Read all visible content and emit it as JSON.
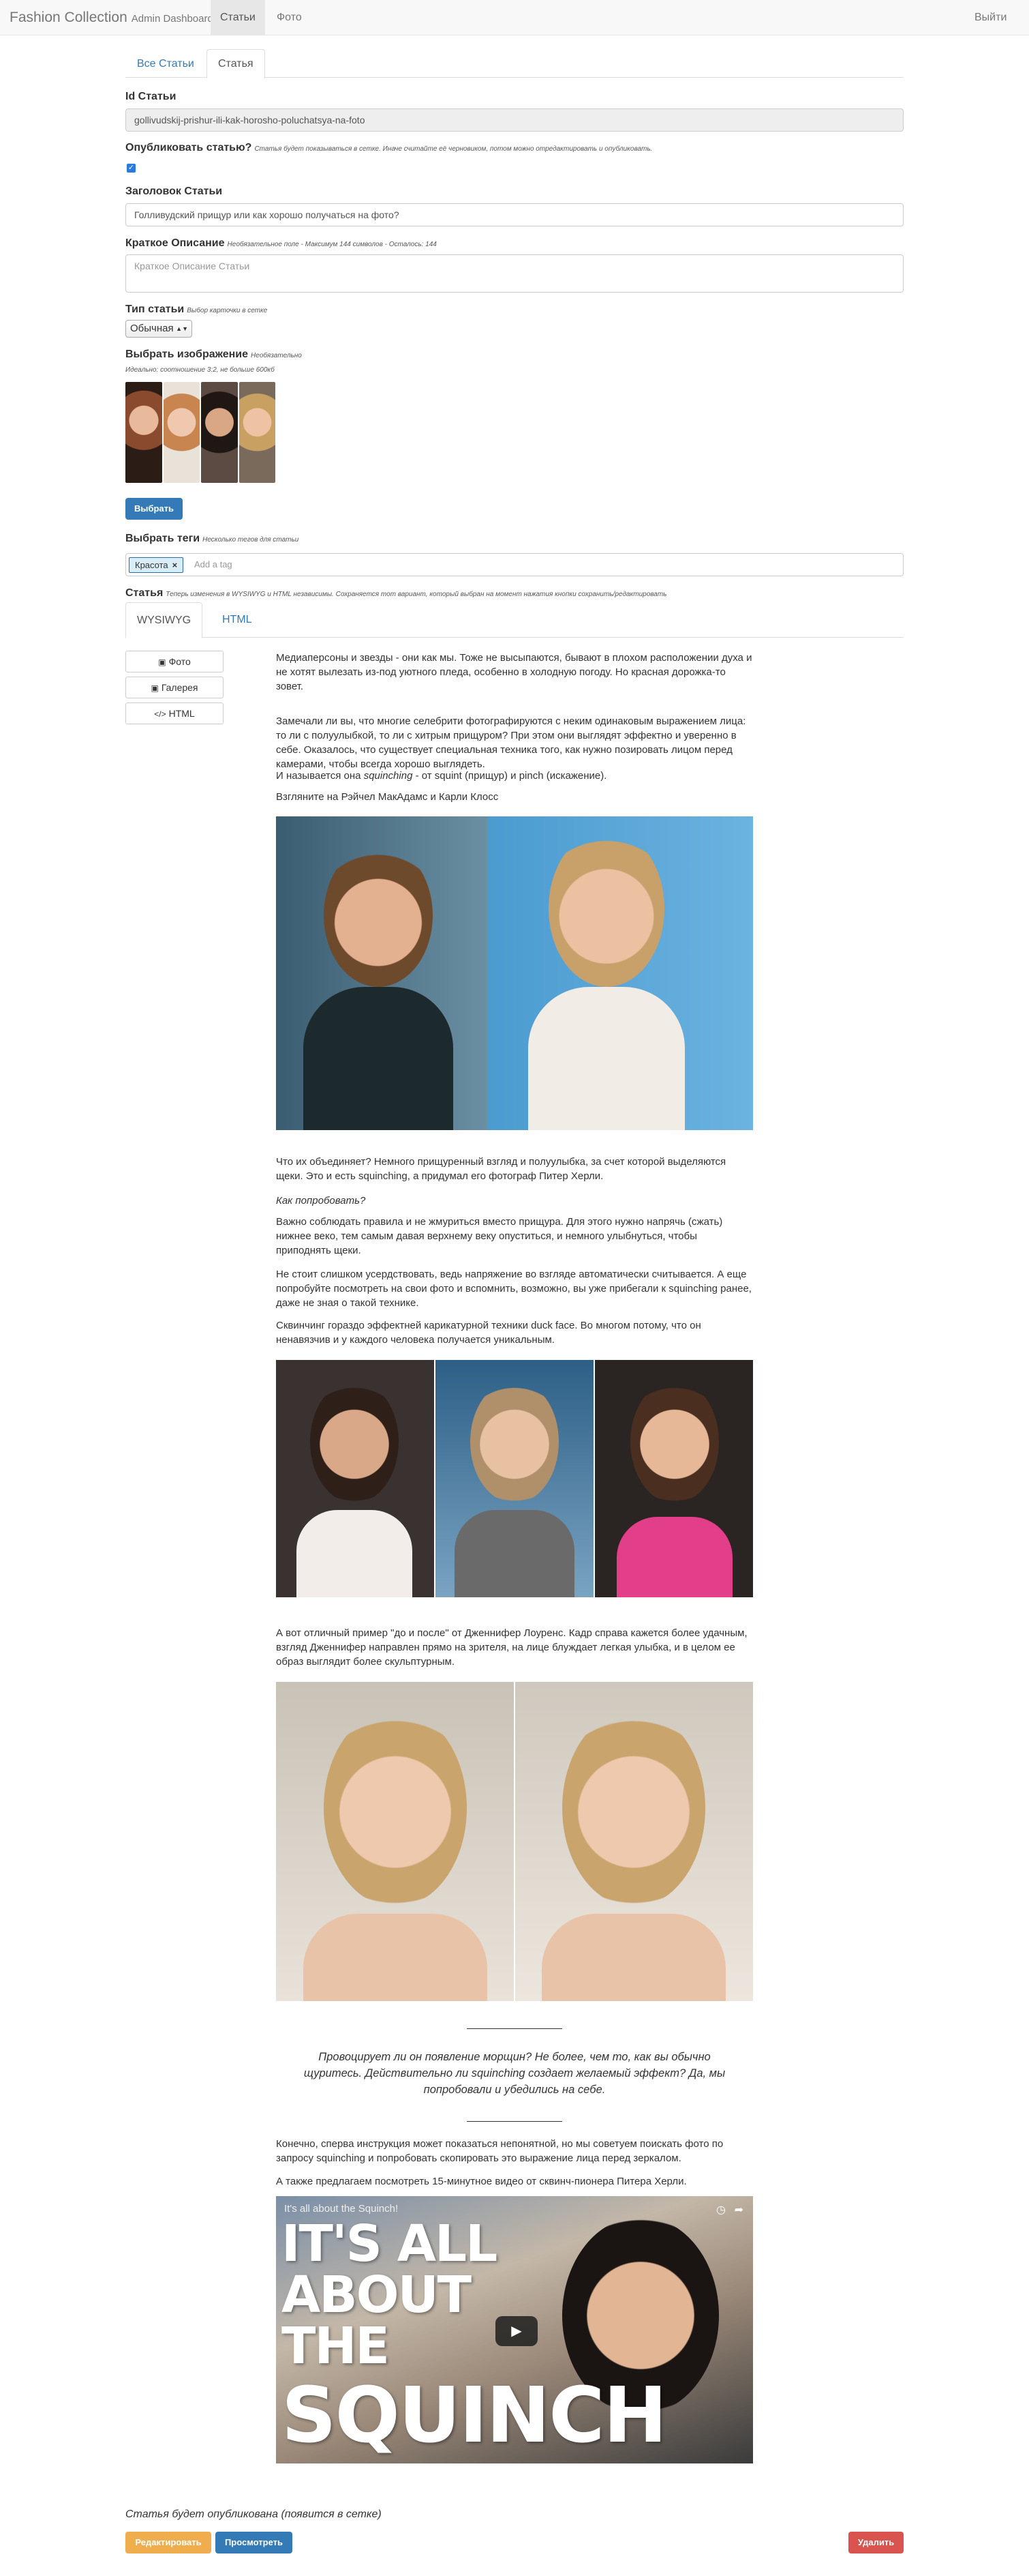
{
  "navbar": {
    "brand": "Fashion Collection",
    "brand_sub": "Admin Dashboard",
    "links": [
      "Статьи",
      "Фото"
    ],
    "logout": "Выйти"
  },
  "tabs": [
    "Все Статьи",
    "Статья"
  ],
  "form": {
    "id_label": "Id Статьи",
    "id_value": "gollivudskij-prishur-ili-kak-horosho-poluchatsya-na-foto",
    "publish_label": "Опубликовать статью?",
    "publish_hint": "Статья будет показываться в сетке. Иначе считайте её черновиком, потом можно отредактировать и опубликовать.",
    "publish_checked": true,
    "title_label": "Заголовок Статьи",
    "title_value": "Голливудский прищур или как хорошо получаться на фото?",
    "summary_label": "Краткое Описание",
    "summary_hint": "Необязательное поле - Максимум 144 символов - Осталось: 144",
    "summary_placeholder": "Краткое Описание Статьи",
    "type_label": "Тип статьи",
    "type_hint": "Выбор карточки в сетке",
    "type_value": "Обычная",
    "image_label": "Выбрать изображение",
    "image_hint": "Необязательно",
    "image_note": "Идеально: соотношение 3:2, не больше 600кб",
    "choose_button": "Выбрать",
    "tags_label": "Выбрать теги",
    "tags_hint": "Несколько тегов для статьи",
    "tags": [
      "Красота"
    ],
    "tags_placeholder": "Add a tag",
    "article_label": "Статья",
    "article_hint": "Теперь изменения в WYSIWYG и HTML независимы. Сохраняется тот вариант, который выбран на момент нажатия кнопки сохранить/редактировать"
  },
  "editor_tabs": [
    "WYSIWYG",
    "HTML"
  ],
  "side_buttons": [
    "Фото",
    "Галерея",
    "HTML"
  ],
  "article": {
    "p1": "Медиаперсоны и звезды - они как мы. Тоже не высыпаются, бывают в плохом расположении духа и не хотят вылезать из-под уютного пледа, особенно в холодную погоду. Но красная дорожка-то зовет.",
    "p2": "Замечали ли вы, что многие селебрити фотографируются с неким одинаковым выражением лица: то ли с полуулыбкой, то ли с хитрым прищуром? При этом они выглядят эффектно и уверенно в себе. Оказалось, что существует специальная техника того, как нужно позировать лицом перед камерами, чтобы всегда хорошо выглядеть.",
    "p3": "И называется она squinching - от squint (прищур) и pinch (искажение).",
    "p4": "Взгляните на Рэйчел МакАдамс и Карли Клосс",
    "p5": "Что их объединяет? Немного прищуренный взгляд и полуулыбка, за счет которой выделяются щеки. Это и есть squinching, а придумал его фотограф Питер Херли.",
    "p6": "Как попробовать?",
    "p7": "Важно соблюдать правила и не жмуриться вместо прищура. Для этого нужно напрячь (сжать) нижнее веко, тем самым давая верхнему веку опуститься, и немного улыбнуться, чтобы приподнять щеки.",
    "p8": "Не стоит слишком усердствовать, ведь напряжение во взгляде автоматически считывается. А еще попробуйте посмотреть на свои фото и вспомнить, возможно, вы уже прибегали к squinching ранее, даже не зная о такой технике.",
    "p9": "Сквинчинг гораздо эффектней карикатурной техники duck face. Во многом потому, что он ненавязчив и у каждого человека получается уникальным.",
    "p10": "А вот отличный пример \"до и после\" от Дженнифер Лоуренс. Кадр справа кажется более удачным, взгляд Дженнифер направлен прямо на зрителя, на лице блуждает легкая улыбка, и в целом ее образ выглядит более скульптурным.",
    "quote": "Провоцирует ли он появление морщин? Не более, чем то, как вы обычно щуритесь. Действительно ли squinching создает желаемый эффект? Да, мы попробовали и убедились на себе.",
    "p11": "Конечно, сперва инструкция может показаться непонятной, но мы советуем поискать фото по запросу squinching и попробовать скопировать это выражение лица перед зеркалом.",
    "p12": "А также предлагаем посмотреть 15-минутное видео от сквинч-пионера Питера Херли.",
    "video_title": "It's all about the Squinch!",
    "video_big": [
      "IT'S ALL",
      "ABOUT",
      "THE",
      "SQUINCH"
    ]
  },
  "footer": {
    "note": "Статья будет опубликована (появится в сетке)",
    "edit_button": "Редактировать",
    "preview_button": "Просмотреть",
    "delete_button": "Удалить"
  }
}
